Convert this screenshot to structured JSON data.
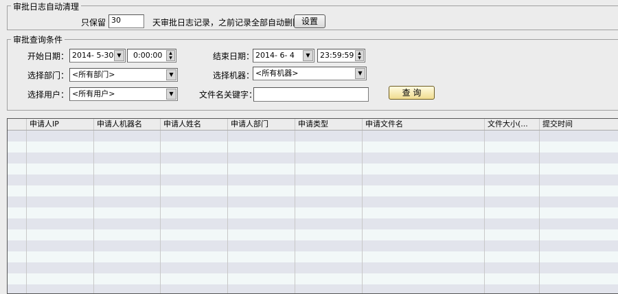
{
  "cleanup": {
    "legend": "审批日志自动清理",
    "keep_label": "只保留",
    "keep_days": "30",
    "suffix": "天审批日志记录，之前记录全部自动删除",
    "set_button": "设置"
  },
  "query": {
    "legend": "审批查询条件",
    "start_label": "开始日期：",
    "start_date": "2014- 5-30",
    "start_time": "0:00:00",
    "end_label": "结束日期：",
    "end_date": "2014- 6- 4",
    "end_time": "23:59:59",
    "dept_label": "选择部门：",
    "dept_value": "<所有部门>",
    "machine_label": "选择机器：",
    "machine_value": "<所有机器>",
    "user_label": "选择用户：",
    "user_value": "<所有用户>",
    "keyword_label": "文件名关键字：",
    "keyword_value": "",
    "query_button": "查 询"
  },
  "table": {
    "columns": [
      "",
      "申请人IP",
      "申请人机器名",
      "申请人姓名",
      "申请人部门",
      "申请类型",
      "申请文件名",
      "文件大小(...",
      "提交时间"
    ]
  }
}
